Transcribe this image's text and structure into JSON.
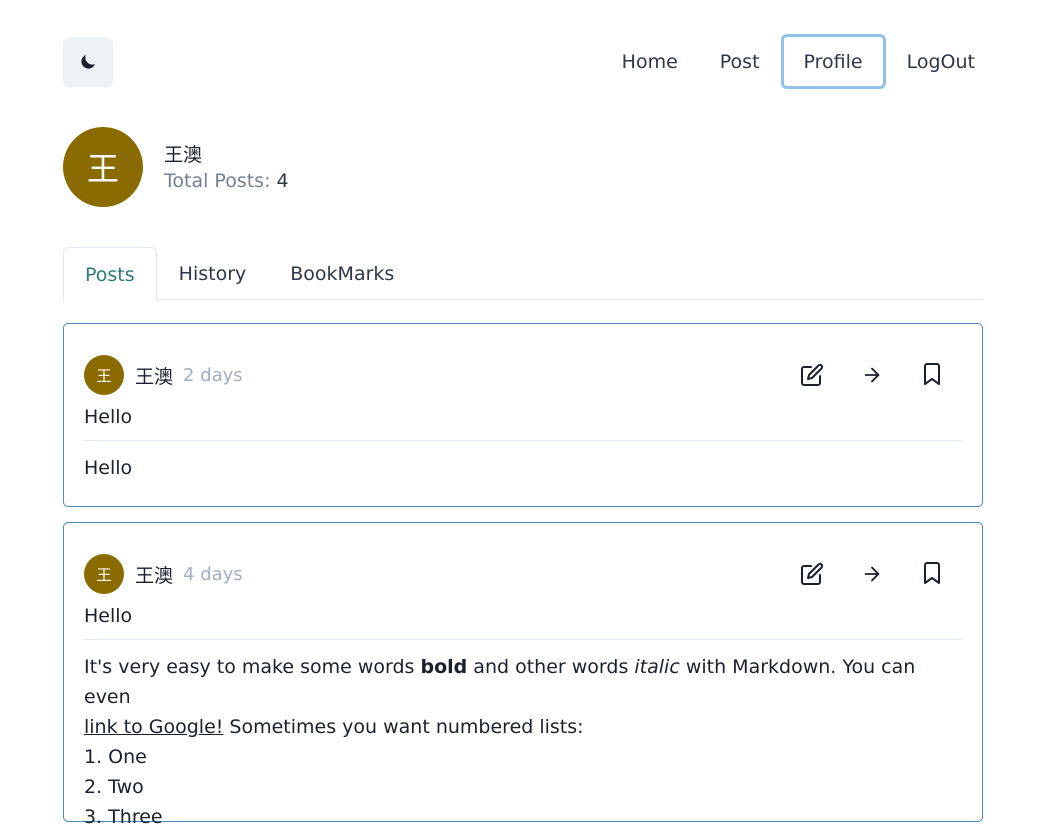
{
  "header": {
    "theme_icon": "moon-icon",
    "nav": [
      {
        "label": "Home"
      },
      {
        "label": "Post"
      },
      {
        "label": "Profile",
        "active": true
      },
      {
        "label": "LogOut"
      }
    ]
  },
  "profile": {
    "avatar_initial": "王",
    "name": "王澳",
    "total_label": "Total Posts:",
    "total_count": "4"
  },
  "tabs": [
    {
      "label": "Posts",
      "active": true
    },
    {
      "label": "History"
    },
    {
      "label": "BookMarks"
    }
  ],
  "posts": [
    {
      "avatar_initial": "王",
      "author": "王澳",
      "time": "2 days",
      "title": "Hello",
      "body": "Hello"
    },
    {
      "avatar_initial": "王",
      "author": "王澳",
      "time": "4 days",
      "title": "Hello",
      "body_parts": {
        "p1": "It's very easy to make some words ",
        "bold": "bold",
        "p2": " and other words ",
        "italic": "italic",
        "p3": " with Markdown. You can even ",
        "link": "link to Google!",
        "p4": " Sometimes you want numbered lists:"
      },
      "list": [
        "1. One",
        "2. Two",
        "3. Three"
      ]
    }
  ],
  "icons": {
    "edit": "edit-icon",
    "go": "arrow-right-icon",
    "bookmark": "bookmark-icon"
  },
  "colors": {
    "avatar_bg": "#8a6b00",
    "card_border": "#4a8bbf",
    "active_tab": "#2c7a7b",
    "active_nav_border": "#90c2e7"
  }
}
